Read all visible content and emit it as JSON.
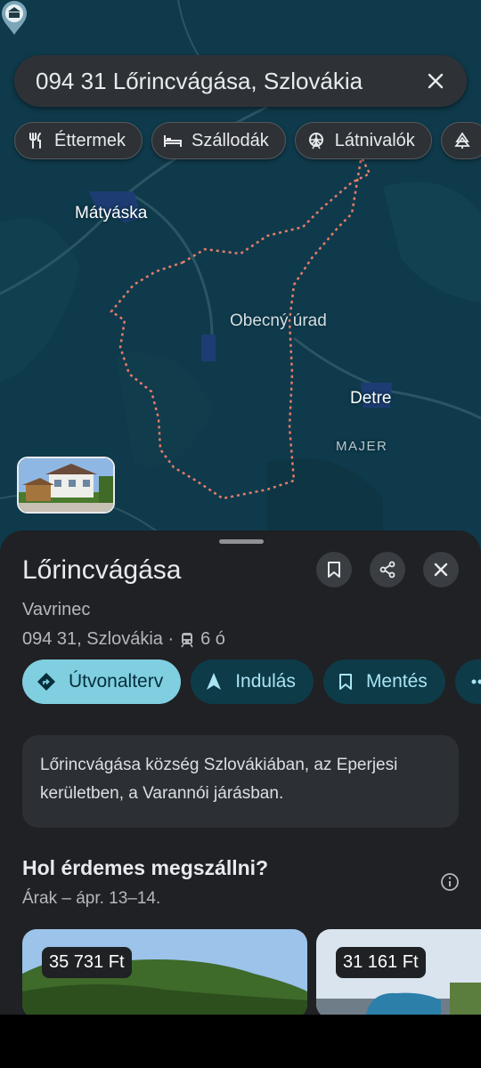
{
  "search": {
    "query": "094 31 Lőrincvágása, Szlovákia"
  },
  "chips": [
    {
      "label": "Éttermek",
      "icon": "fork-knife-icon"
    },
    {
      "label": "Szállodák",
      "icon": "bed-icon"
    },
    {
      "label": "Látnivalók",
      "icon": "ferris-wheel-icon"
    }
  ],
  "map": {
    "labels": {
      "matyaska": "Mátyáska",
      "poi": "Obecný úrad",
      "detre": "Detre",
      "majer": "MAJER"
    }
  },
  "place": {
    "title": "Lőrincvágása",
    "alt_name": "Vavrinec",
    "address": "094 31, Szlovákia ·",
    "transit_time": "6 ó",
    "description": "Lőrincvágása község Szlovákiában, az Eperjesi kerületben, a Varannói járásban."
  },
  "actions": {
    "directions": "Útvonalterv",
    "start": "Indulás",
    "save": "Mentés"
  },
  "stay": {
    "title": "Hol érdemes megszállni?",
    "dates": "Árak – ápr. 13–14.",
    "hotels": [
      {
        "price": "35 731 Ft"
      },
      {
        "price": "31 161 Ft"
      }
    ]
  },
  "colors": {
    "map_bg": "#0f3a4b",
    "sheet_bg": "#1f2124",
    "accent": "#7fcfe0",
    "boundary": "#e57c6a"
  }
}
